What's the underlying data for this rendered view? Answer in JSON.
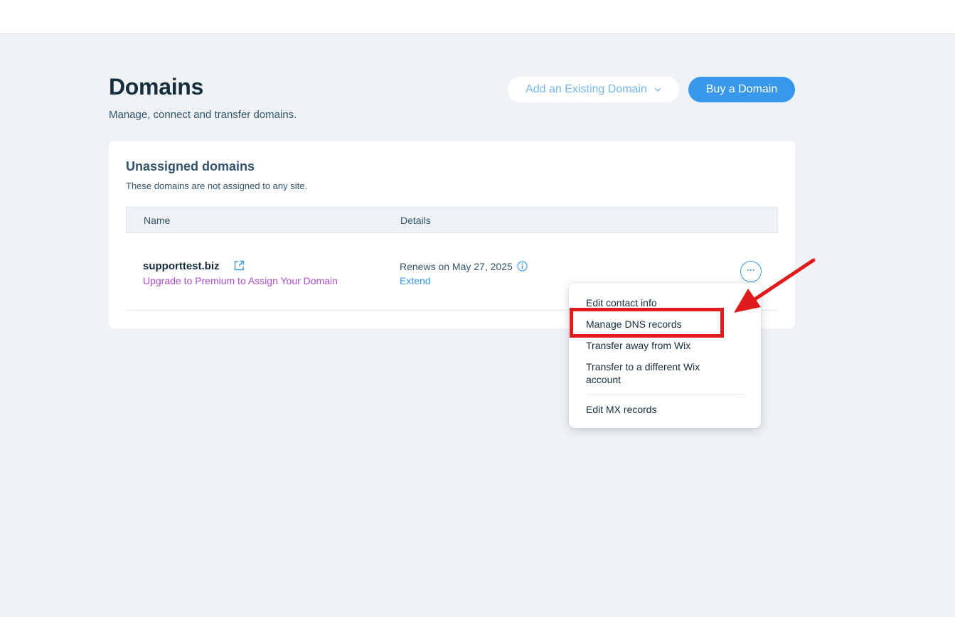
{
  "page": {
    "title": "Domains",
    "subtitle": "Manage, connect and transfer domains."
  },
  "header_actions": {
    "add_existing_label": "Add an Existing Domain",
    "buy_label": "Buy a Domain"
  },
  "section": {
    "title": "Unassigned domains",
    "subtitle": "These domains are not assigned to any site.",
    "columns": [
      "Name",
      "Details"
    ]
  },
  "domains": [
    {
      "name": "supporttest.biz",
      "upgrade_link": "Upgrade to Premium to Assign Your Domain",
      "renews": "Renews on May 27, 2025",
      "extend_link": "Extend"
    }
  ],
  "actions_menu": {
    "items": [
      "Edit contact info",
      "Manage DNS records",
      "Transfer away from Wix",
      "Transfer to a different Wix account",
      "Edit MX records"
    ],
    "highlighted_item": "Manage DNS records"
  },
  "colors": {
    "accent": "#3899ec",
    "upgrade": "#aa4dc8",
    "annotation": "#e01b1b",
    "background": "#eff3f6"
  },
  "icons": [
    "external-link-icon",
    "info-icon",
    "chevron-down-icon",
    "more-options-icon",
    "annotation-arrow"
  ]
}
